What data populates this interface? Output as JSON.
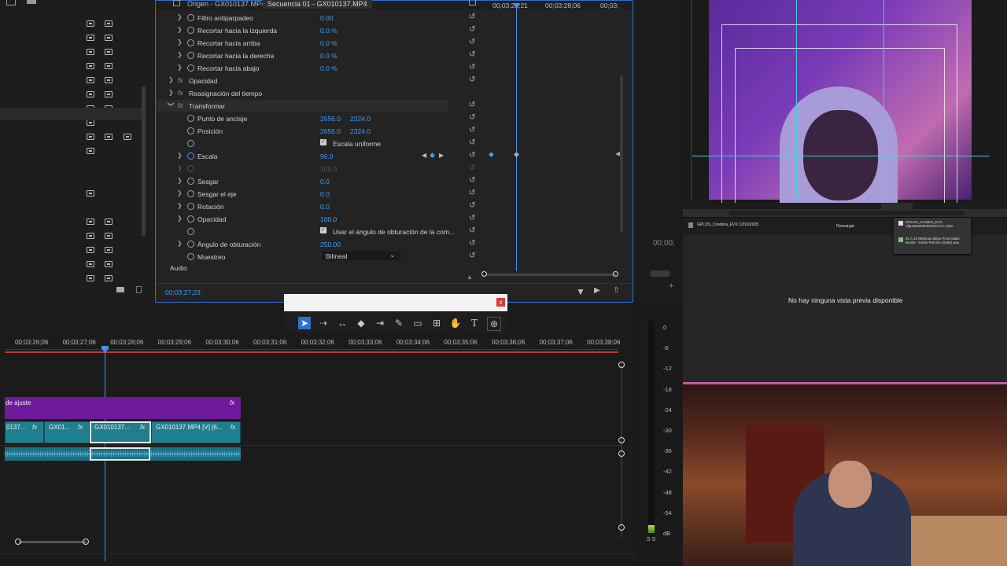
{
  "colors": {
    "accent": "#2f6fd1",
    "value_blue": "#3d9cf6",
    "playhead": "#4a8ff0",
    "clip_purple": "#6e1a9c",
    "clip_teal": "#1f7f8e",
    "close_red": "#d53b3b"
  },
  "effect_controls": {
    "tabs": [
      "Origen - GX010137.MP4",
      "Secuencia 01 - GX010137.MP4"
    ],
    "ruler": [
      "00;03;28;21",
      "00;03;28;06",
      "00;03;"
    ],
    "rows": [
      {
        "label": "Filtro antiparpadeo",
        "value": "0.00"
      },
      {
        "label": "Recortar hacia la izquierda",
        "value": "0.0 %"
      },
      {
        "label": "Recortar hacia arriba",
        "value": "0.0 %"
      },
      {
        "label": "Recortar hacia la derecha",
        "value": "0.0 %"
      },
      {
        "label": "Recortar hacia abajo",
        "value": "0.0 %"
      }
    ],
    "opacity_section": "Opacidad",
    "time_remap_section": "Reasignación del tiempo",
    "transform_section": "Transformar",
    "anchor_label": "Punto de anclaje",
    "anchor_x": "2656.0",
    "anchor_y": "2324.0",
    "position_label": "Posición",
    "position_x": "2656.0",
    "position_y": "2324.0",
    "uniform_scale_label": "Escala uniforme",
    "scale_label": "Escala",
    "scale_value": "96.0",
    "scale_width_value": "100.0",
    "skew_label": "Sesgar",
    "skew_value": "0.0",
    "skew_axis_label": "Sesgar el eje",
    "skew_axis_value": "0.0",
    "rotation_label": "Rotación",
    "rotation_value": "0.0",
    "opacity_label": "Opacidad",
    "opacity_value": "100.0",
    "shutter_comp_label": "Usar el ángulo de obturación de la com...",
    "shutter_label": "Ángulo de obturación",
    "shutter_value": "250.00",
    "sampling_label": "Muestreo",
    "sampling_value": "Bilineal",
    "audio_section": "Audio",
    "timecode": "00;03;27;23"
  },
  "timeline": {
    "timecodes": [
      "00;03;26;06",
      "00;03;27;06",
      "00;03;28;06",
      "00;03;29;06",
      "00;03;30;06",
      "00;03;31;06",
      "00;03;32;06",
      "00;03;33;06",
      "00;03;34;06",
      "00;03;35;06",
      "00;03;36;06",
      "00;03;37;06",
      "00;03;38;06"
    ],
    "adjust_clip": "de ajuste",
    "clips": [
      "0137...",
      "GX01...",
      "GX010137...",
      "GX010137.MP4 [V] [6..."
    ],
    "fx_label": "fx"
  },
  "meter": {
    "ticks": [
      "0",
      "-6",
      "-12",
      "-18",
      "-24",
      "-30",
      "-36",
      "-42",
      "-48",
      "-54",
      "dB"
    ],
    "bottom": "S S"
  },
  "tools": {
    "close": "x"
  },
  "program_monitor": {
    "timecode_partial": "00;00;"
  },
  "browser": {
    "file_title": "GPLOS_Creatina_EVX 12/10/2025",
    "download_label": "Descargar",
    "no_preview": "No hay ninguna vista previa disponible",
    "dl_item_1": "GPLOS_Creatina_EVX ofgHas0000006J2mAAA.cube",
    "dl_item_2": "01 A 10 Métricas Milan Prod Sable Books - Doble Porción (0186).wav"
  }
}
